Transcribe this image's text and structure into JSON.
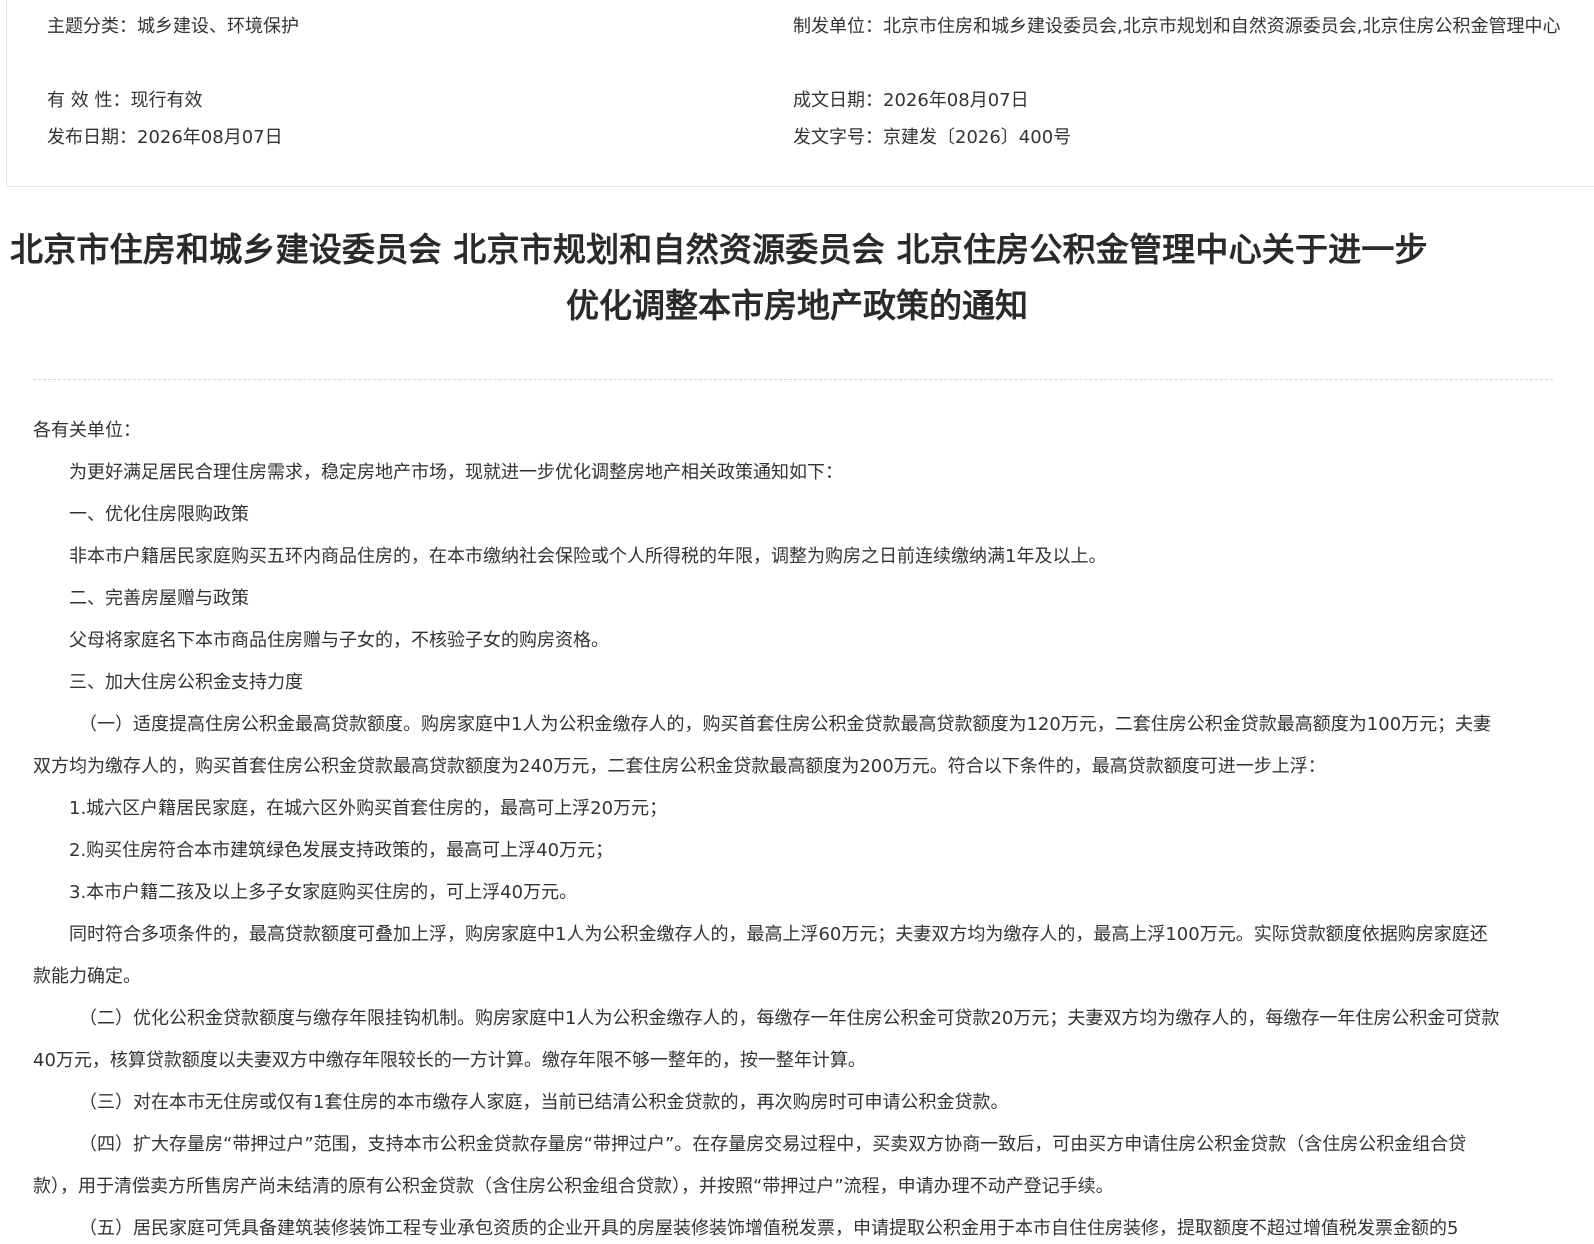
{
  "meta": {
    "topic_label": "主题分类：",
    "topic_value": "城乡建设、环境保护",
    "validity_label": "有 效 性：",
    "validity_value": "现行有效",
    "publish_date_label": "发布日期：",
    "publish_date_value": "2026年08月07日",
    "issuer_label": "制发单位：",
    "issuer_value": "北京市住房和城乡建设委员会,北京市规划和自然资源委员会,北京住房公积金管理中心",
    "written_date_label": "成文日期：",
    "written_date_value": "2026年08月07日",
    "doc_number_label": "发文字号：",
    "doc_number_value": "京建发〔2026〕400号"
  },
  "title": {
    "line1": "北京市住房和城乡建设委员会 北京市规划和自然资源委员会 北京住房公积金管理中心关于进一步",
    "line2": "优化调整本市房地产政策的通知"
  },
  "body": {
    "salutation": "各有关单位：",
    "intro": "为更好满足居民合理住房需求，稳定房地产市场，现就进一步优化调整房地产相关政策通知如下：",
    "section1_heading": "一、优化住房限购政策",
    "section1_text": "非本市户籍居民家庭购买五环内商品住房的，在本市缴纳社会保险或个人所得税的年限，调整为购房之日前连续缴纳满1年及以上。",
    "section2_heading": "二、完善房屋赠与政策",
    "section2_text": "父母将家庭名下本市商品住房赠与子女的，不核验子女的购房资格。",
    "section3_heading": "三、加大住房公积金支持力度",
    "item1": "（一）适度提高住房公积金最高贷款额度。购房家庭中1人为公积金缴存人的，购买首套住房公积金贷款最高贷款额度为120万元，二套住房公积金贷款最高额度为100万元；夫妻双方均为缴存人的，购买首套住房公积金贷款最高贷款额度为240万元，二套住房公积金贷款最高额度为200万元。符合以下条件的，最高贷款额度可进一步上浮：",
    "cond1": "1.城六区户籍居民家庭，在城六区外购买首套住房的，最高可上浮20万元；",
    "cond2": "2.购买住房符合本市建筑绿色发展支持政策的，最高可上浮40万元；",
    "cond3": "3.本市户籍二孩及以上多子女家庭购买住房的，可上浮40万元。",
    "stack_text": "同时符合多项条件的，最高贷款额度可叠加上浮，购房家庭中1人为公积金缴存人的，最高上浮60万元；夫妻双方均为缴存人的，最高上浮100万元。实际贷款额度依据购房家庭还款能力确定。",
    "item2": "（二）优化公积金贷款额度与缴存年限挂钩机制。购房家庭中1人为公积金缴存人的，每缴存一年住房公积金可贷款20万元；夫妻双方均为缴存人的，每缴存一年住房公积金可贷款40万元，核算贷款额度以夫妻双方中缴存年限较长的一方计算。缴存年限不够一整年的，按一整年计算。",
    "item3": "（三）对在本市无住房或仅有1套住房的本市缴存人家庭，当前已结清公积金贷款的，再次购房时可申请公积金贷款。",
    "item4": "（四）扩大存量房“带押过户”范围，支持本市公积金贷款存量房“带押过户”。在存量房交易过程中，买卖双方协商一致后，可由买方申请住房公积金贷款（含住房公积金组合贷款），用于清偿卖方所售房产尚未结清的原有公积金贷款（含住房公积金组合贷款），并按照“带押过户”流程，申请办理不动产登记手续。",
    "item5_partial": "（五）居民家庭可凭具备建筑装修装饰工程专业承包资质的企业开具的房屋装修装饰增值税发票，申请提取公积金用于本市自住住房装修，提取额度不超过增值税发票金额的5"
  }
}
